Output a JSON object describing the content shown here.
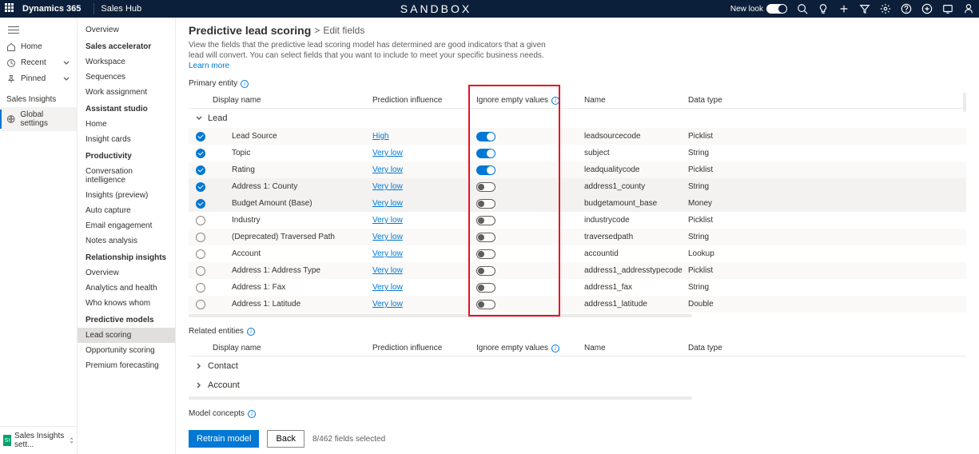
{
  "topbar": {
    "brand": "Dynamics 365",
    "hub": "Sales Hub",
    "center": "SANDBOX",
    "newlook": "New look"
  },
  "rail": {
    "items": [
      {
        "label": "Home",
        "icon": "home"
      },
      {
        "label": "Recent",
        "icon": "clock",
        "chev": true
      },
      {
        "label": "Pinned",
        "icon": "pin",
        "chev": true
      }
    ],
    "section": "Sales Insights",
    "global": "Global settings",
    "footer": "Sales Insights sett..."
  },
  "sidebar": {
    "groups": [
      {
        "header": "",
        "items": [
          "Overview"
        ]
      },
      {
        "header": "Sales accelerator",
        "items": [
          "Workspace",
          "Sequences",
          "Work assignment"
        ]
      },
      {
        "header": "Assistant studio",
        "items": [
          "Home",
          "Insight cards"
        ]
      },
      {
        "header": "Productivity",
        "items": [
          "Conversation intelligence",
          "Insights (preview)",
          "Auto capture",
          "Email engagement",
          "Notes analysis"
        ]
      },
      {
        "header": "Relationship insights",
        "items": [
          "Overview",
          "Analytics and health",
          "Who knows whom"
        ]
      },
      {
        "header": "Predictive models",
        "items": [
          "Lead scoring",
          "Opportunity scoring",
          "Premium forecasting"
        ]
      }
    ],
    "selected": "Lead scoring"
  },
  "content": {
    "bc1": "Predictive lead scoring",
    "bc2": "Edit fields",
    "desc": "View the fields that the predictive lead scoring model has determined are good indicators that a given lead will convert. You can select fields that you want to include to meet your specific business needs.",
    "learn": "Learn more",
    "primary_label": "Primary entity",
    "related_label": "Related entities",
    "concepts_label": "Model concepts",
    "columns": {
      "dn": "Display name",
      "pi": "Prediction influence",
      "ig": "Ignore empty values",
      "nm": "Name",
      "dt": "Data type"
    },
    "group": "Lead",
    "rows": [
      {
        "ck": true,
        "dn": "Lead Source",
        "pi": "High",
        "ig": true,
        "nm": "leadsourcecode",
        "dt": "Picklist"
      },
      {
        "ck": true,
        "dn": "Topic",
        "pi": "Very low",
        "ig": true,
        "nm": "subject",
        "dt": "String"
      },
      {
        "ck": true,
        "dn": "Rating",
        "pi": "Very low",
        "ig": true,
        "nm": "leadqualitycode",
        "dt": "Picklist"
      },
      {
        "ck": true,
        "dn": "Address 1: County",
        "pi": "Very low",
        "ig": false,
        "nm": "address1_county",
        "dt": "String"
      },
      {
        "ck": true,
        "dn": "Budget Amount (Base)",
        "pi": "Very low",
        "ig": false,
        "nm": "budgetamount_base",
        "dt": "Money"
      },
      {
        "ck": false,
        "dn": "Industry",
        "pi": "Very low",
        "ig": false,
        "nm": "industrycode",
        "dt": "Picklist"
      },
      {
        "ck": false,
        "dn": "(Deprecated) Traversed Path",
        "pi": "Very low",
        "ig": false,
        "nm": "traversedpath",
        "dt": "String"
      },
      {
        "ck": false,
        "dn": "Account",
        "pi": "Very low",
        "ig": false,
        "nm": "accountid",
        "dt": "Lookup"
      },
      {
        "ck": false,
        "dn": "Address 1: Address Type",
        "pi": "Very low",
        "ig": false,
        "nm": "address1_addresstypecode",
        "dt": "Picklist"
      },
      {
        "ck": false,
        "dn": "Address 1: Fax",
        "pi": "Very low",
        "ig": false,
        "nm": "address1_fax",
        "dt": "String"
      },
      {
        "ck": false,
        "dn": "Address 1: Latitude",
        "pi": "Very low",
        "ig": false,
        "nm": "address1_latitude",
        "dt": "Double"
      }
    ],
    "related_groups": [
      "Contact",
      "Account"
    ],
    "retrain": "Retrain model",
    "back": "Back",
    "count": "8/462 fields selected"
  }
}
